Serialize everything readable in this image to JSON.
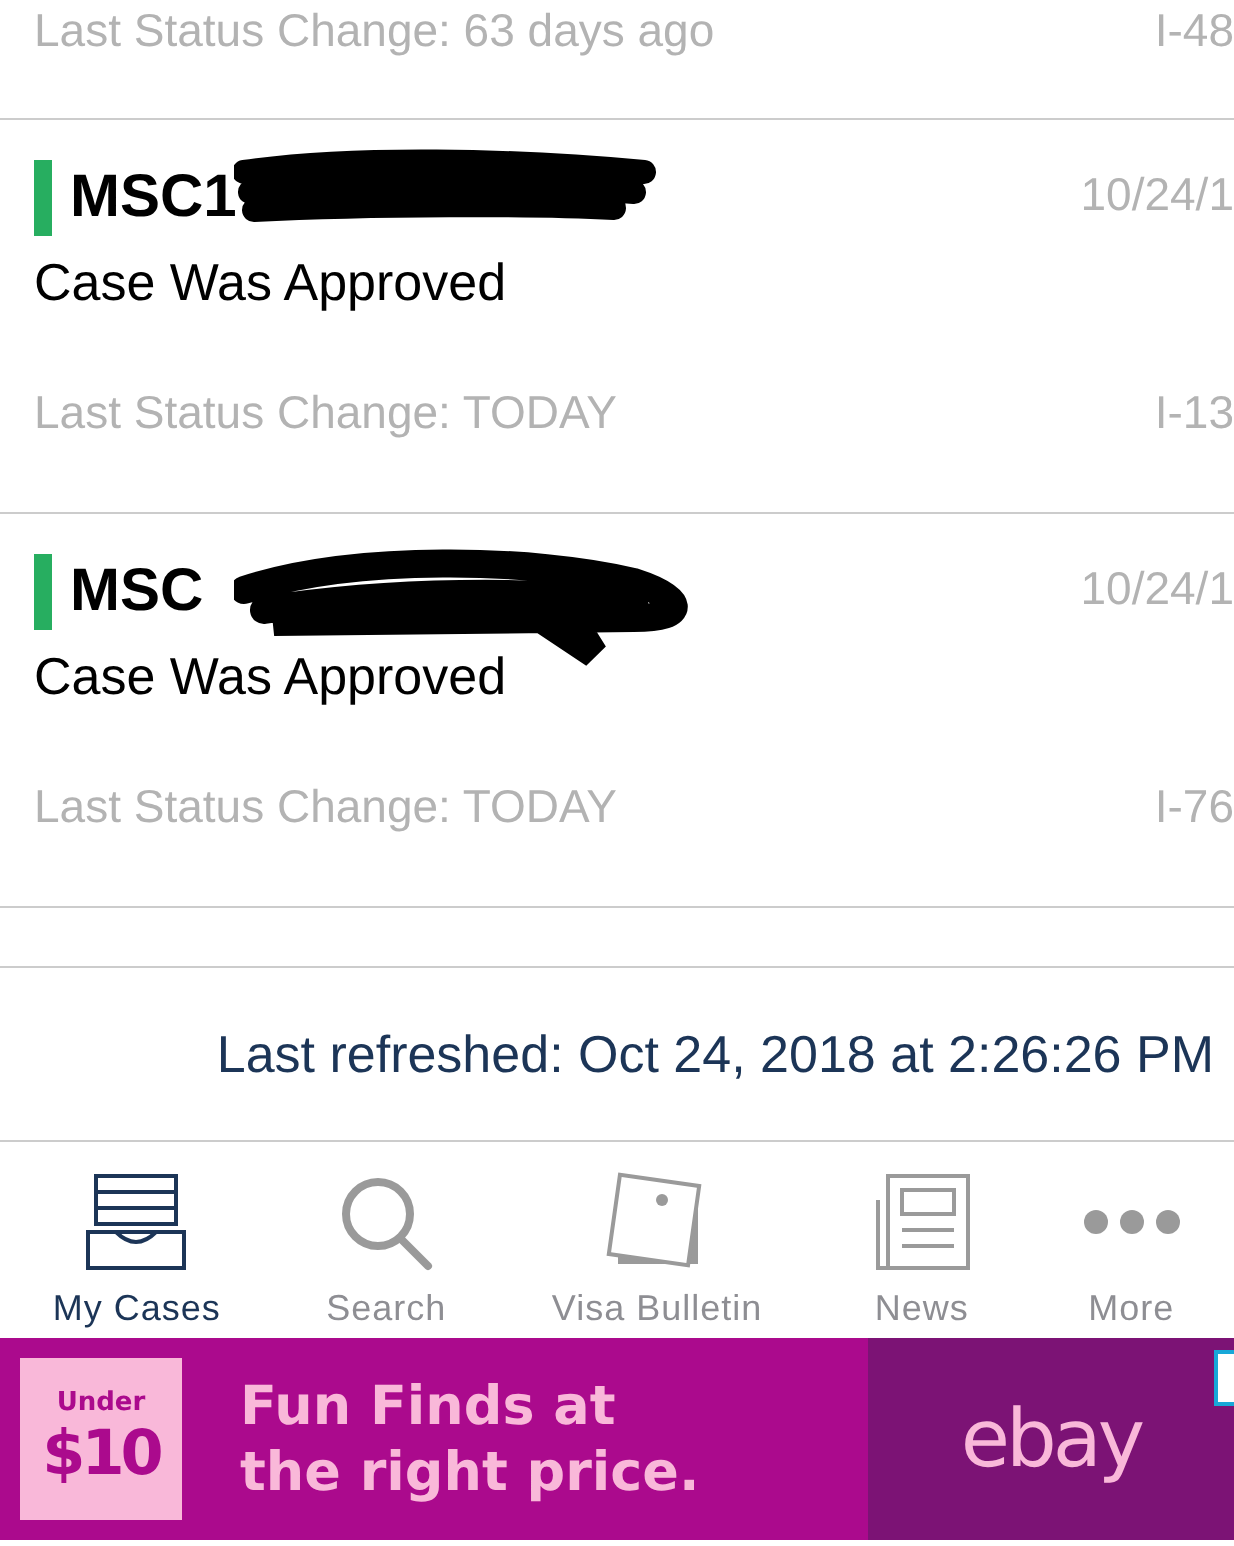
{
  "top_row": {
    "last_change": "Last Status Change: 63 days ago",
    "form": "I-48"
  },
  "cases": [
    {
      "case_number": "MSC1",
      "date": "10/24/1",
      "status": "Case Was Approved",
      "last_change": "Last Status Change: TODAY",
      "form": "I-13",
      "color": "#27ae60"
    },
    {
      "case_number": "MSC",
      "date": "10/24/1",
      "status": "Case Was Approved",
      "last_change": "Last Status Change: TODAY",
      "form": "I-76",
      "color": "#27ae60"
    }
  ],
  "last_refreshed": "Last refreshed: Oct 24, 2018 at 2:26:26 PM",
  "tabs": [
    {
      "kind": "cases",
      "label": "My Cases",
      "selected": true
    },
    {
      "kind": "search",
      "label": "Search",
      "selected": false
    },
    {
      "kind": "bulletin",
      "label": "Visa Bulletin",
      "selected": false
    },
    {
      "kind": "news",
      "label": "News",
      "selected": false
    },
    {
      "kind": "more",
      "label": "More",
      "selected": false
    }
  ],
  "ad": {
    "badge_top": "Under",
    "badge_price": "$10",
    "headline": "Fun Finds at the right price.",
    "brand": "ebay"
  }
}
